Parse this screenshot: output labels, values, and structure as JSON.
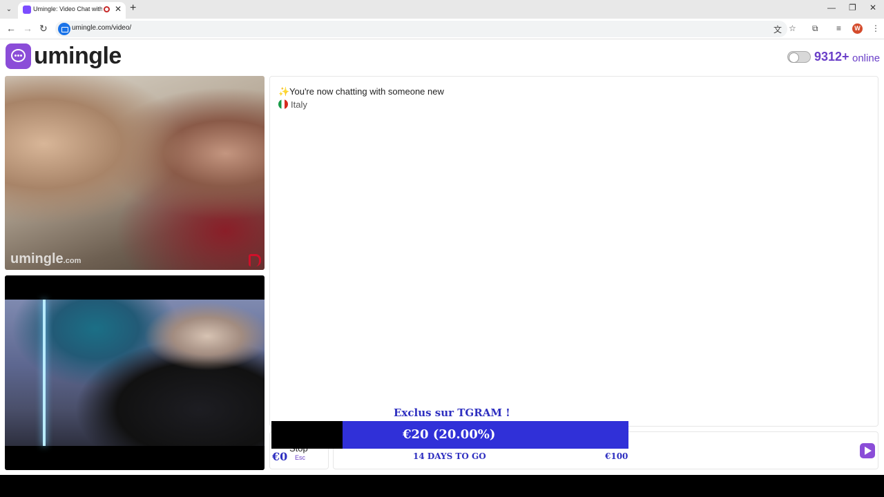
{
  "browser": {
    "tab_title": "Umingle: Video Chat with S",
    "url": "umingle.com/video/",
    "profile_initial": "W"
  },
  "header": {
    "logo_text": "umingle",
    "online_count": "9312+",
    "online_label": "online"
  },
  "video": {
    "watermark_main": "umingle",
    "watermark_suffix": ".com"
  },
  "chat": {
    "status_message": "You're now chatting with someone new",
    "country": "Italy"
  },
  "controls": {
    "stop_label": "Stop",
    "esc_label": "Esc"
  },
  "donation": {
    "title": "Exclus sur TGRAM !",
    "bar_label": "€20 (20.00%)",
    "progress_percent": 20,
    "min_label": "€0",
    "days_label": "14 DAYS TO GO",
    "max_label": "€100"
  },
  "colors": {
    "brand": "#8b4dd8",
    "online": "#6a3fc8",
    "donation": "#3030d8"
  }
}
